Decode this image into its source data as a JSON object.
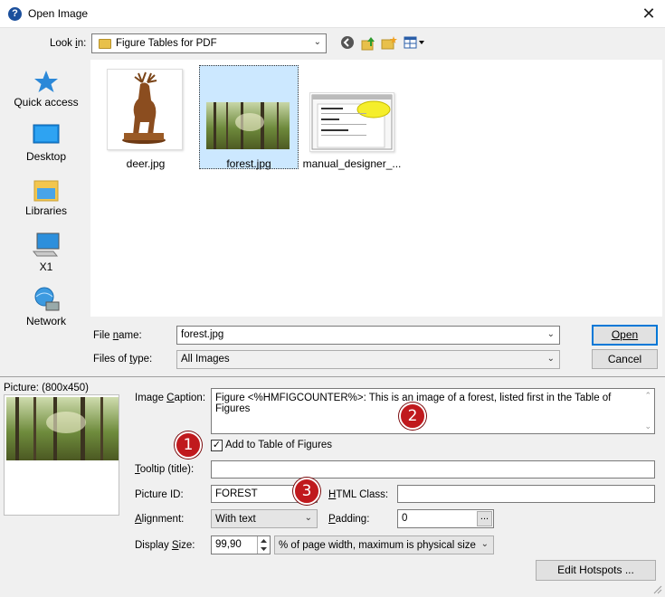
{
  "window": {
    "title": "Open Image"
  },
  "lookin": {
    "label": "Look in:",
    "value": "Figure Tables for PDF"
  },
  "places": [
    {
      "label": "Quick access",
      "icon": "star-icon"
    },
    {
      "label": "Desktop",
      "icon": "desktop-icon"
    },
    {
      "label": "Libraries",
      "icon": "libraries-icon"
    },
    {
      "label": "X1",
      "icon": "computer-icon"
    },
    {
      "label": "Network",
      "icon": "network-icon"
    }
  ],
  "files": [
    {
      "name": "deer.jpg"
    },
    {
      "name": "forest.jpg",
      "selected": true
    },
    {
      "name": "manual_designer_..."
    }
  ],
  "manual_thumb": {
    "heading": "Table of Figures",
    "line2": "Table of Tables",
    "line3": "Table of Custom Entries",
    "note": "Tables of Figures automatically..."
  },
  "filename": {
    "label": "File name:",
    "value": "forest.jpg"
  },
  "filetype": {
    "label": "Files of type:",
    "value": "All Images"
  },
  "buttons": {
    "open": "Open",
    "cancel": "Cancel",
    "edit_hotspots": "Edit Hotspots ..."
  },
  "picture": {
    "label": "Picture: (800x450)"
  },
  "caption": {
    "label": "Image Caption:",
    "value": "Figure <%HMFIGCOUNTER%>: This is an image of a forest, listed first in the Table of Figures"
  },
  "add_tof": {
    "label": "Add to Table of Figures",
    "checked": true
  },
  "tooltip": {
    "label": "Tooltip (title):",
    "value": ""
  },
  "picture_id": {
    "label": "Picture ID:",
    "value": "FOREST"
  },
  "html_class": {
    "label": "HTML Class:",
    "value": ""
  },
  "alignment": {
    "label": "Alignment:",
    "value": "With text"
  },
  "padding": {
    "label": "Padding:",
    "value": "0",
    "button": "..."
  },
  "display_size": {
    "label": "Display Size:",
    "value": "99,90",
    "unit": "% of page width, maximum is physical size"
  },
  "badges": [
    "1",
    "2",
    "3"
  ],
  "colors": {
    "accent": "#0078d7",
    "badge": "#c0191d",
    "selection": "#cce8ff"
  }
}
